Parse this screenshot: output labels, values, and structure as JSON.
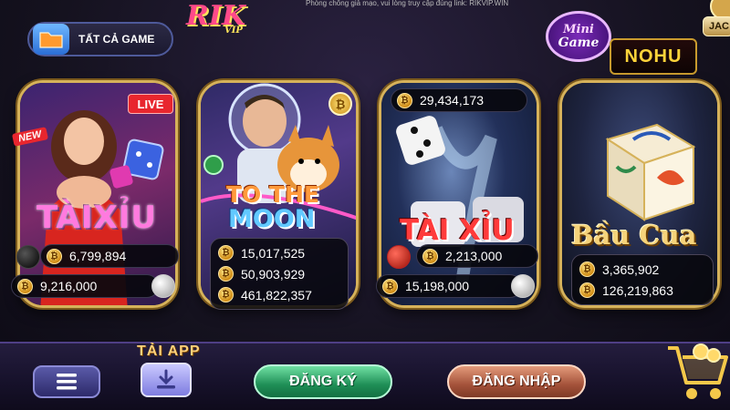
{
  "header": {
    "ticker_text": "Phòng chống giả mạo, vui lòng truy cập đúng link: RIKVIP.WIN",
    "all_games_label": "TẤT CẢ GAME",
    "brand_logo": "RIK VIP",
    "minigame_logo": [
      "Mini",
      "Game"
    ],
    "nohu_logo": "NOHU",
    "corner_tag": "JAC"
  },
  "games": [
    {
      "title": "TÀIXỈU",
      "badges": {
        "live": "LIVE",
        "new": "NEW"
      },
      "jackpots": [
        "6,799,894",
        "9,216,000"
      ]
    },
    {
      "title_line1": "TO THE",
      "title_line2": "MOON",
      "jackpots": [
        "15,017,525",
        "50,903,929",
        "461,822,357"
      ]
    },
    {
      "title": "TÀI XỈU",
      "jackpots": [
        "29,434,173",
        "2,213,000",
        "15,198,000"
      ]
    },
    {
      "title": "Bầu Cua",
      "jackpots": [
        "3,365,902",
        "126,219,863"
      ]
    }
  ],
  "coin_symbol": "₿",
  "footer": {
    "app_label": "TẢI APP",
    "register_label": "ĐĂNG KÝ",
    "login_label": "ĐĂNG NHẬP"
  },
  "colors": {
    "register": "#1f8e56",
    "login": "#a4523a",
    "card_border": "#d6b25a"
  }
}
